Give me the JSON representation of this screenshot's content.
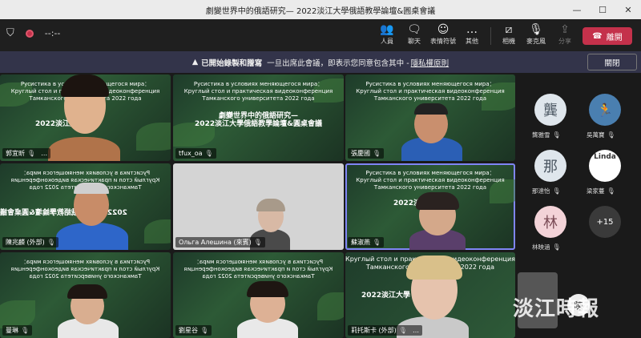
{
  "window": {
    "title": "劇變世界中的俄語研究— 2022淡江大學俄語教學論壇&圓桌會議",
    "minimize": "—",
    "maximize": "☐",
    "close": "✕"
  },
  "toolbar": {
    "timer": "--:--",
    "people": "人員",
    "chat": "聊天",
    "react": "表情符號",
    "more": "其他",
    "camera": "相機",
    "mic": "麥克風",
    "share": "分享",
    "leave": "離開"
  },
  "banner": {
    "text1": "已開始錄製和謄寫",
    "text2": "一旦出席此會議，即表示您同意包含其中 -",
    "link": "隱私權原則",
    "close": "關閉"
  },
  "slide": {
    "ru1": "Русистика в условиях меняющегося мира：",
    "ru2": "Круглый стол и практическая видеоконференция",
    "ru3": "Тамканского университета 2022 года",
    "zh1": "劇變世界中的俄語研究—",
    "zh2": "2022淡江大學俄語教學論壇&圓桌會議",
    "zh_short": "2022淡江大學"
  },
  "tiles": [
    {
      "name": "郭宜昕",
      "more": "…"
    },
    {
      "name": "tfux_oa"
    },
    {
      "name": "張慶國"
    },
    {
      "name": "陳兆麟 (外部)"
    },
    {
      "name": "Ольга Алешина (來賓)"
    },
    {
      "name": "蘇淑燕"
    },
    {
      "name": "曼琳"
    },
    {
      "name": "劉星谷"
    },
    {
      "name": "莉托斯卡 (外部)",
      "more": "…"
    }
  ],
  "side": {
    "people": [
      {
        "initial": "龔",
        "name": "龔雅雪"
      },
      {
        "initial": "",
        "name": "吳萬寶"
      },
      {
        "initial": "那",
        "name": "那達怡"
      },
      {
        "initial": "Linda",
        "name": "梁家蔓"
      },
      {
        "initial": "林",
        "name": "林映涵"
      }
    ],
    "more_count": "+15"
  },
  "watermark": {
    "text": "淡江時報",
    "badge": "陳"
  },
  "colors": {
    "leave": "#c4314b",
    "banner": "#33344a",
    "selected": "#7f85f5"
  }
}
